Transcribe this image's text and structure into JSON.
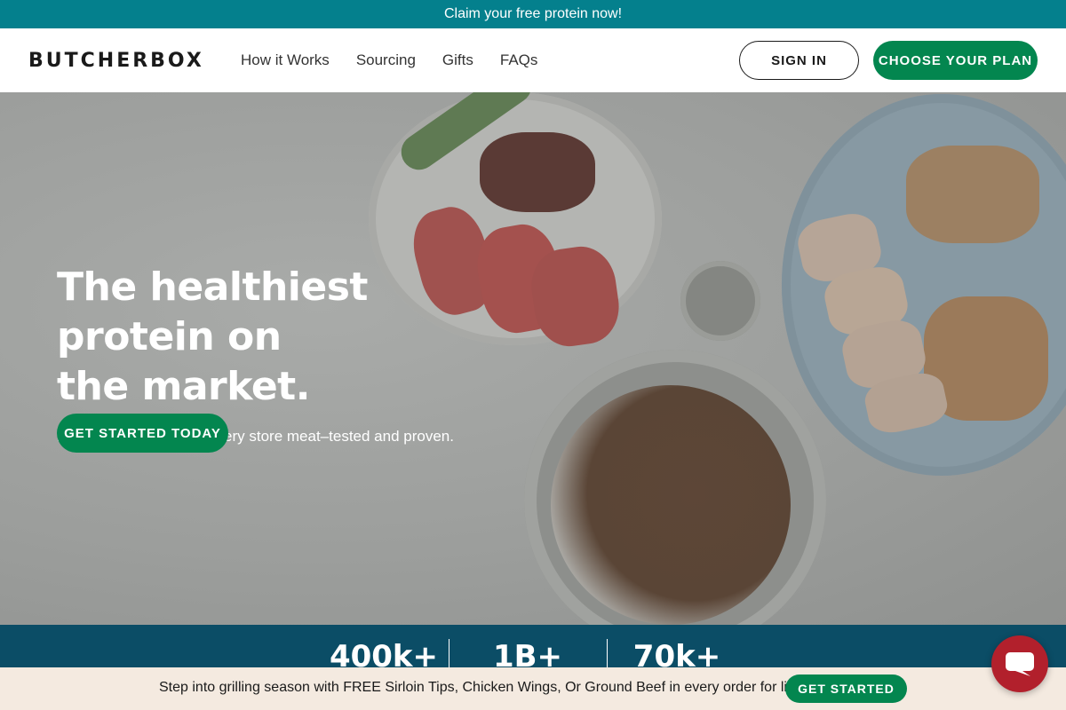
{
  "promo_bar": {
    "text": "Claim your free protein now!"
  },
  "header": {
    "logo": "BUTCHERBOX",
    "nav": [
      "How it Works",
      "Sourcing",
      "Gifts",
      "FAQs"
    ],
    "sign_in": "SIGN IN",
    "choose_plan": "CHOOSE YOUR PLAN"
  },
  "hero": {
    "title_line1": "The healthiest protein on",
    "title_line2": "the market.",
    "subtitle": "More nutritious than grocery store meat–tested and proven.",
    "cta": "GET STARTED TODAY"
  },
  "stats": [
    "400k+",
    "1B+",
    "70k+"
  ],
  "bottom_banner": {
    "text": "Step into grilling season with FREE Sirloin Tips, Chicken Wings, Or Ground Beef in every order for life.",
    "cta": "GET STARTED"
  },
  "colors": {
    "promo_teal": "#04808d",
    "brand_green": "#03864f",
    "stats_navy": "#0b4d66",
    "banner_beige": "#f4eae0",
    "chat_red": "#b2202c"
  },
  "icons": {
    "chat": "chat-bubble-icon"
  }
}
